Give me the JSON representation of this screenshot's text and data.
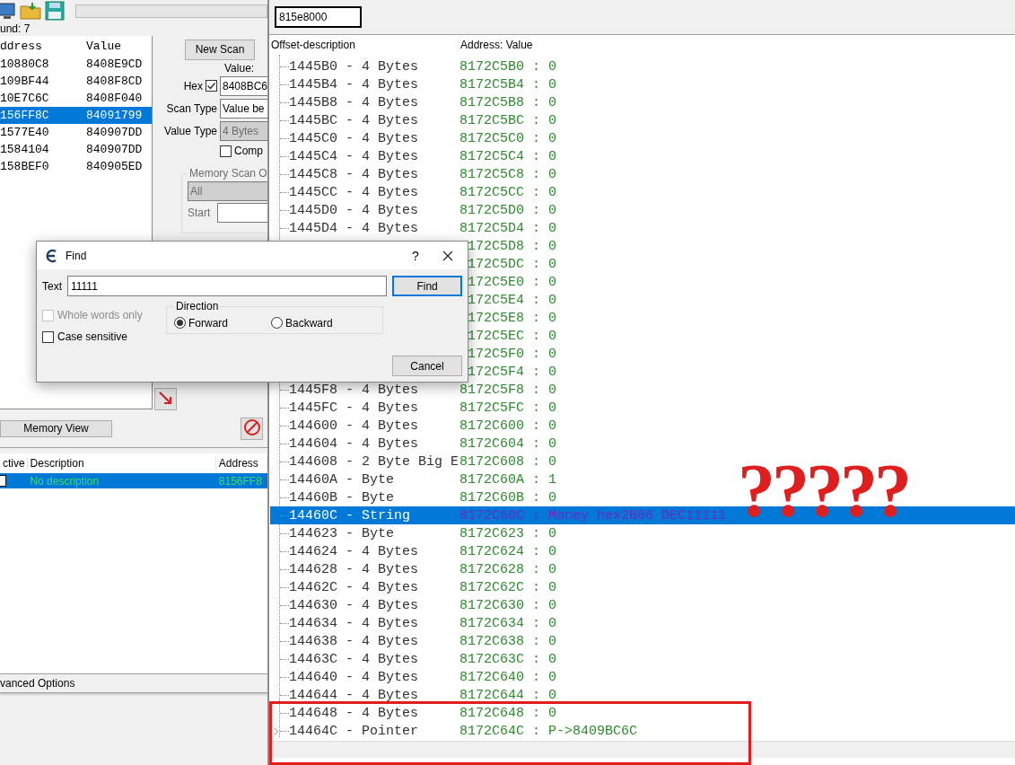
{
  "scan_window": {
    "found": "und: 7",
    "results": {
      "columns": [
        "ddress",
        "Value"
      ],
      "rows": [
        {
          "address": "10880C8",
          "value": "8408E9CD",
          "selected": false
        },
        {
          "address": "109BF44",
          "value": "8408F8CD",
          "selected": false
        },
        {
          "address": "10E7C6C",
          "value": "8408F040",
          "selected": false
        },
        {
          "address": "156FF8C",
          "value": "84091799",
          "selected": true
        },
        {
          "address": "1577E40",
          "value": "840907DD",
          "selected": false
        },
        {
          "address": "1584104",
          "value": "840907DD",
          "selected": false
        },
        {
          "address": "158BEF0",
          "value": "840905ED",
          "selected": false
        }
      ]
    },
    "new_scan": "New Scan",
    "value_label": "Value:",
    "hex": {
      "label": "Hex",
      "checked": true
    },
    "value_input": "8408BC6",
    "scan_type": {
      "label": "Scan Type",
      "value": "Value be"
    },
    "value_type": {
      "label": "Value Type",
      "value": "4 Bytes",
      "disabled": true
    },
    "compare": {
      "label": "Comp",
      "checked": false
    },
    "memory_scan": {
      "title": "Memory Scan O",
      "region": "All",
      "start_label": "Start"
    },
    "memory_view": "Memory View",
    "address_list": {
      "columns": [
        "ctive",
        "Description",
        "Address"
      ],
      "rows": [
        {
          "active": false,
          "description": "No description",
          "address": "8156FF8",
          "selected": true
        }
      ]
    },
    "advanced": "vanced Options"
  },
  "structure_window": {
    "base_address": "815e8000",
    "columns": [
      "Offset-description",
      "Address: Value"
    ],
    "rows": [
      {
        "offset": "1445B0 - 4 Bytes",
        "address": "8172C5B0 : 0",
        "selected": false
      },
      {
        "offset": "1445B4 - 4 Bytes",
        "address": "8172C5B4 : 0",
        "selected": false
      },
      {
        "offset": "1445B8 - 4 Bytes",
        "address": "8172C5B8 : 0",
        "selected": false
      },
      {
        "offset": "1445BC - 4 Bytes",
        "address": "8172C5BC : 0",
        "selected": false
      },
      {
        "offset": "1445C0 - 4 Bytes",
        "address": "8172C5C0 : 0",
        "selected": false
      },
      {
        "offset": "1445C4 - 4 Bytes",
        "address": "8172C5C4 : 0",
        "selected": false
      },
      {
        "offset": "1445C8 - 4 Bytes",
        "address": "8172C5C8 : 0",
        "selected": false
      },
      {
        "offset": "1445CC - 4 Bytes",
        "address": "8172C5CC : 0",
        "selected": false
      },
      {
        "offset": "1445D0 - 4 Bytes",
        "address": "8172C5D0 : 0",
        "selected": false
      },
      {
        "offset": "1445D4 - 4 Bytes",
        "address": "8172C5D4 : 0",
        "selected": false
      },
      {
        "address": "172C5D8 : 0",
        "selected": false
      },
      {
        "address": "172C5DC : 0",
        "selected": false
      },
      {
        "address": "172C5E0 : 0",
        "selected": false
      },
      {
        "address": "172C5E4 : 0",
        "selected": false
      },
      {
        "address": "172C5E8 : 0",
        "selected": false
      },
      {
        "address": "172C5EC : 0",
        "selected": false
      },
      {
        "address": "172C5F0 : 0",
        "selected": false
      },
      {
        "address": "172C5F4 : 0",
        "selected": false
      },
      {
        "offset": "1445F8 - 4 Bytes",
        "address": "8172C5F8 : 0",
        "selected": false
      },
      {
        "offset": "1445FC - 4 Bytes",
        "address": "8172C5FC : 0",
        "selected": false
      },
      {
        "offset": "144600 - 4 Bytes",
        "address": "8172C600 : 0",
        "selected": false
      },
      {
        "offset": "144604 - 4 Bytes",
        "address": "8172C604 : 0",
        "selected": false
      },
      {
        "offset": "144608 - 2 Byte Big E",
        "address": "8172C608 : 0",
        "selected": false
      },
      {
        "offset": "14460A - Byte",
        "address": "8172C60A : 1",
        "selected": false
      },
      {
        "offset": "14460B - Byte",
        "address": "8172C60B : 0",
        "selected": false
      },
      {
        "offset": "14460C - String",
        "address": "8172C60C : Money hex2B66 DEC11111",
        "selected": true
      },
      {
        "offset": "144623 - Byte",
        "address": "8172C623 : 0",
        "selected": false
      },
      {
        "offset": "144624 - 4 Bytes",
        "address": "8172C624 : 0",
        "selected": false
      },
      {
        "offset": "144628 - 4 Bytes",
        "address": "8172C628 : 0",
        "selected": false
      },
      {
        "offset": "14462C - 4 Bytes",
        "address": "8172C62C : 0",
        "selected": false
      },
      {
        "offset": "144630 - 4 Bytes",
        "address": "8172C630 : 0",
        "selected": false
      },
      {
        "offset": "144634 - 4 Bytes",
        "address": "8172C634 : 0",
        "selected": false
      },
      {
        "offset": "144638 - 4 Bytes",
        "address": "8172C638 : 0",
        "selected": false
      },
      {
        "offset": "14463C - 4 Bytes",
        "address": "8172C63C : 0",
        "selected": false
      },
      {
        "offset": "144640 - 4 Bytes",
        "address": "8172C640 : 0",
        "selected": false
      },
      {
        "offset": "144644 - 4 Bytes",
        "address": "8172C644 : 0",
        "selected": false
      },
      {
        "offset": "144648 - 4 Bytes",
        "address": "8172C648 : 0",
        "selected": false
      },
      {
        "offset": "14464C - Pointer",
        "address": "8172C64C : P->8409BC6C",
        "selected": false,
        "expandable": true
      }
    ]
  },
  "find_dialog": {
    "title": "Find",
    "help": "?",
    "text_label": "Text",
    "text_value": "11111",
    "find_button": "Find",
    "whole_words": {
      "label": "Whole words only",
      "checked": false,
      "disabled": true
    },
    "case_sensitive": {
      "label": "Case sensitive",
      "checked": false,
      "disabled": false
    },
    "direction": {
      "title": "Direction",
      "options": [
        {
          "label": "Forward",
          "selected": true
        },
        {
          "label": "Backward",
          "selected": false
        }
      ]
    },
    "cancel_button": "Cancel"
  },
  "annotation": {
    "marks": "?????"
  }
}
